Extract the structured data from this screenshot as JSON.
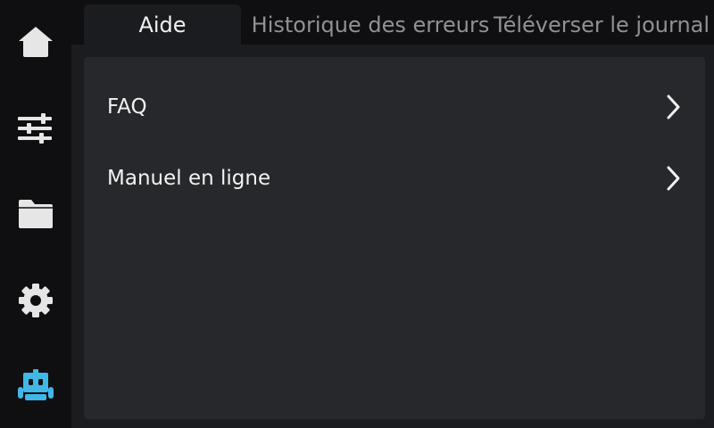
{
  "sidebar": {
    "items": [
      {
        "icon": "home-icon",
        "active": false
      },
      {
        "icon": "sliders-icon",
        "active": false
      },
      {
        "icon": "folder-icon",
        "active": false
      },
      {
        "icon": "gear-icon",
        "active": false
      },
      {
        "icon": "robot-icon",
        "active": true
      }
    ],
    "inactive_color": "#e6e6e6",
    "active_color": "#3fb8e8"
  },
  "tabs": [
    {
      "label": "Aide",
      "active": true
    },
    {
      "label": "Historique des erreurs",
      "active": false
    },
    {
      "label": "Téléverser le journal",
      "active": false
    }
  ],
  "help_menu": {
    "items": [
      {
        "label": "FAQ",
        "icon": "chevron-right-icon"
      },
      {
        "label": "Manuel en ligne",
        "icon": "chevron-right-icon"
      }
    ]
  },
  "colors": {
    "background": "#1b1c1f",
    "panel": "#27282c",
    "text": "#f2f2f2",
    "muted_text": "#8f9196"
  }
}
